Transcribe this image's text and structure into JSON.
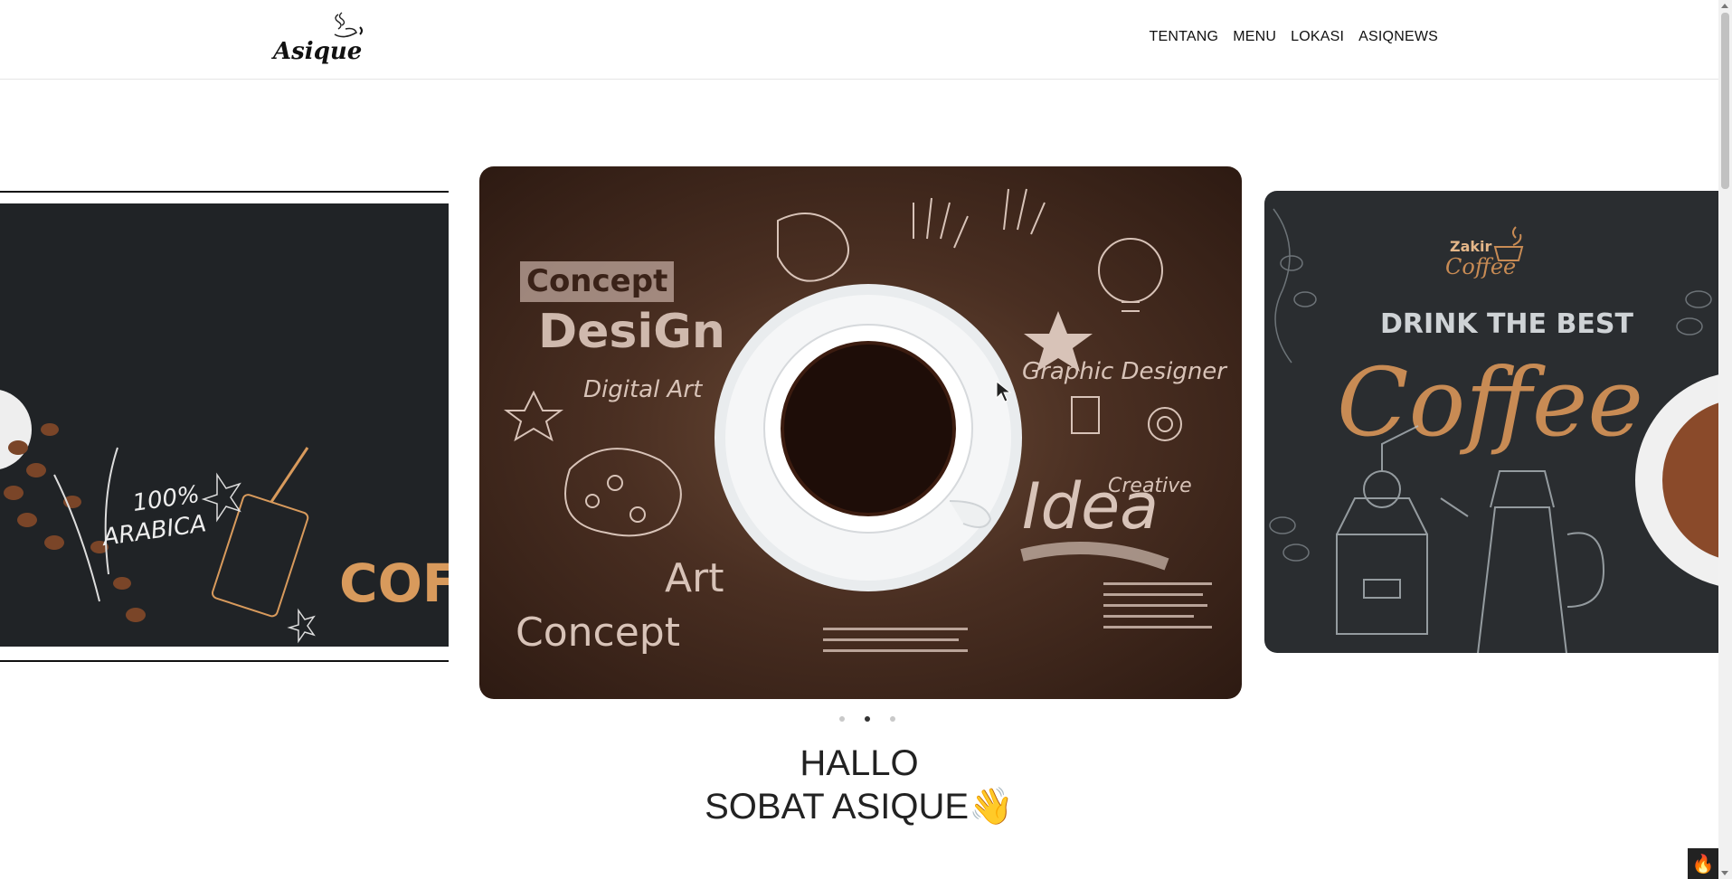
{
  "brand": {
    "logo_text": "Asique"
  },
  "nav": {
    "items": [
      "TENTANG",
      "MENU",
      "LOKASI",
      "ASIQNEWS"
    ]
  },
  "slides": {
    "left": {
      "text1": "100%",
      "text2": "ARABICA",
      "text3": "COFFEE"
    },
    "center": {
      "concept": "Concept",
      "design": "DesiGn",
      "digital_art": "Digital Art",
      "graphic_designer": "Graphic Designer",
      "creative": "Creative",
      "idea": "Idea",
      "art": "Art",
      "concept2": "Concept"
    },
    "right": {
      "brand1": "Zakir",
      "brand2": "Coffee",
      "headline": "DRINK THE BEST",
      "script": "Coffee"
    }
  },
  "carousel": {
    "slide_count": 3,
    "active_index": 1
  },
  "greeting": {
    "line1": "HALLO",
    "line2": "SOBAT ASIQUE",
    "emoji": "👋"
  },
  "widget": {
    "icon": "🔥"
  }
}
